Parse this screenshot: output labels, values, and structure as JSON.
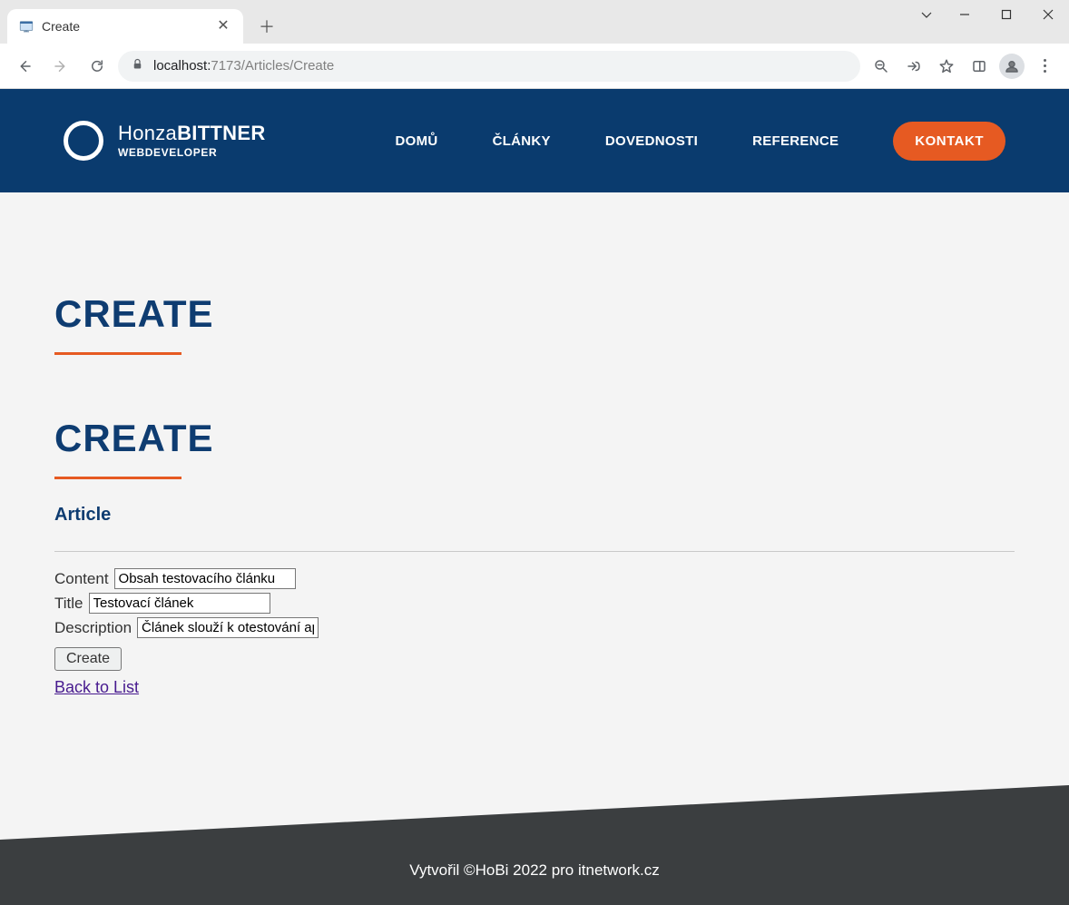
{
  "browser": {
    "tab_title": "Create",
    "url_scheme": "localhost:",
    "url_host": "",
    "url_rest": "7173/Articles/Create"
  },
  "site": {
    "brand_first": "Honza",
    "brand_last": "BITTNER",
    "brand_sub": "WEBDEVELOPER",
    "nav": {
      "home": "DOMŮ",
      "articles": "ČLÁNKY",
      "skills": "DOVEDNOSTI",
      "references": "REFERENCE",
      "contact": "KONTAKT"
    }
  },
  "page": {
    "heading1": "CREATE",
    "heading2": "CREATE",
    "subheading": "Article",
    "labels": {
      "content": "Content",
      "title": "Title",
      "description": "Description"
    },
    "values": {
      "content": "Obsah testovacího článku",
      "title": "Testovací článek",
      "description": "Článek slouží k otestování ap"
    },
    "submit": "Create",
    "back_link": "Back to List"
  },
  "footer": {
    "text": "Vytvořil ©HoBi 2022 pro itnetwork.cz"
  }
}
